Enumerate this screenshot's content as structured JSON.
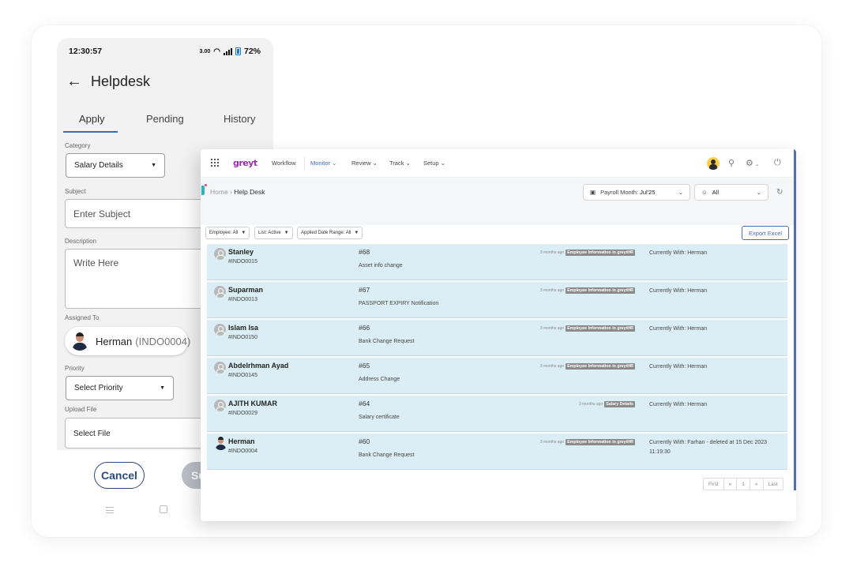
{
  "phone": {
    "status_time": "12:30:57",
    "status_net": "3.00",
    "battery": "72%",
    "title": "Helpdesk",
    "tabs": [
      "Apply",
      "Pending",
      "History"
    ],
    "form": {
      "category_label": "Category",
      "category_value": "Salary Details",
      "subject_label": "Subject",
      "subject_placeholder": "Enter Subject",
      "description_label": "Description",
      "description_placeholder": "Write Here",
      "assigned_label": "Assigned To",
      "assignee_name": "Herman",
      "assignee_id": "(INDO0004)",
      "priority_label": "Priority",
      "priority_value": "Select Priority",
      "upload_label": "Upload File",
      "upload_value": "Select File"
    },
    "cancel_label": "Cancel",
    "submit_label": "Su"
  },
  "desktop": {
    "logo": "greyt",
    "nav": [
      "Workflow",
      "Monitor",
      "Review",
      "Track",
      "Setup"
    ],
    "breadcrumb_home": "Home",
    "breadcrumb_sep": "›",
    "breadcrumb_current": "Help Desk",
    "payroll_label": "Payroll Month:",
    "payroll_value": "Jul'25",
    "filter_all": "All",
    "chips": [
      "Employee: All",
      "List: Active",
      "Applied Date Range: All"
    ],
    "export_label": "Export Excel",
    "tickets": [
      {
        "name": "Stanley",
        "code": "#INDO0015",
        "num": "#68",
        "title": "Asset info change",
        "ago": "3 months ago",
        "tag": "Employee Information in greytHR",
        "with": "Currently With: Herman",
        "photo": false
      },
      {
        "name": "Suparman",
        "code": "#INDO0013",
        "num": "#67",
        "title": "PASSPORT EXPIRY Notification",
        "ago": "3 months ago",
        "tag": "Employee Information in greytHR",
        "with": "Currently With: Herman",
        "photo": false
      },
      {
        "name": "Islam Isa",
        "code": "#INDO0150",
        "num": "#66",
        "title": "Bank Change Request",
        "ago": "3 months ago",
        "tag": "Employee Information in greytHR",
        "with": "Currently With: Herman",
        "photo": false
      },
      {
        "name": "Abdelrhman Ayad",
        "code": "#INDO0145",
        "num": "#65",
        "title": "Address Change",
        "ago": "3 months ago",
        "tag": "Employee Information in greytHR",
        "with": "Currently With: Herman",
        "photo": false
      },
      {
        "name": "AJITH KUMAR",
        "code": "#INDO0029",
        "num": "#64",
        "title": "Salary certificate",
        "ago": "3 months ago",
        "tag": "Salary Details",
        "with": "Currently With: Herman",
        "photo": false
      },
      {
        "name": "Herman",
        "code": "#INDO0004",
        "num": "#60",
        "title": "Bank Change Request",
        "ago": "3 months ago",
        "tag": "Employee Information in greytHR",
        "with": "Currently With: Farhan - deleted at 15 Dec 2023 11:19:30",
        "photo": true
      }
    ],
    "pager": [
      "First",
      "«",
      "1",
      "»",
      "Last"
    ]
  }
}
